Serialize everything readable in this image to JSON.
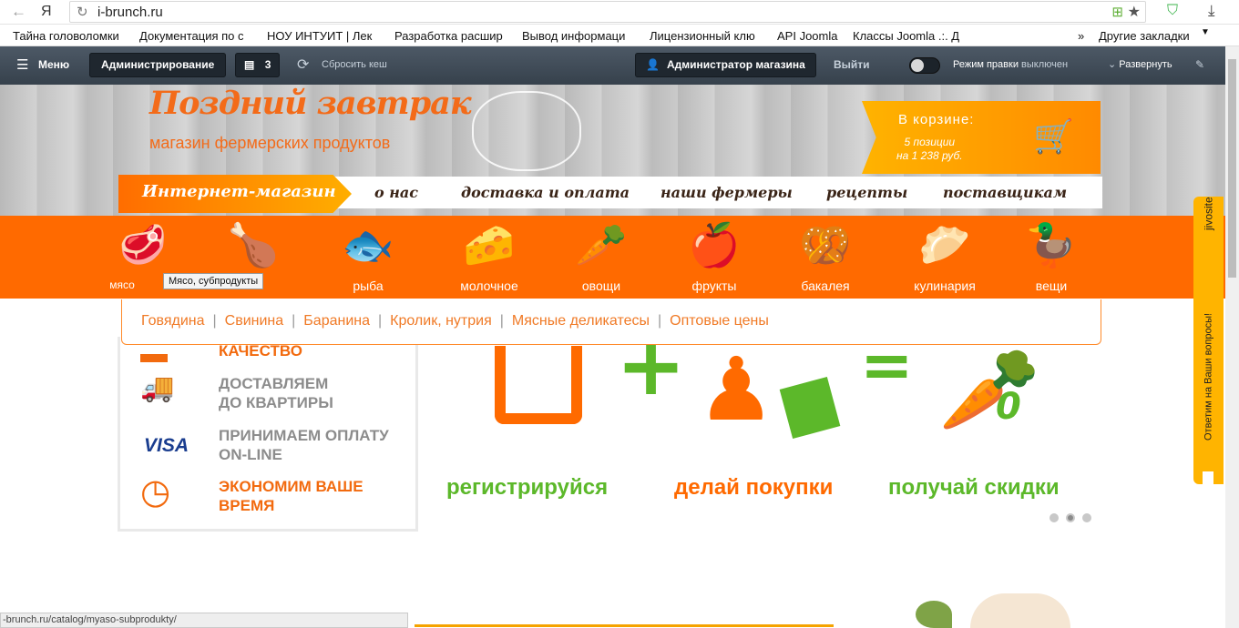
{
  "browser": {
    "yandex": "Я",
    "url": "i-brunch.ru",
    "bookmarks": [
      "Тайна головоломки",
      "Документация по с",
      "НОУ ИНТУИТ | Лек",
      "Разработка расшир",
      "Вывод информаци",
      "Лицензионный клю",
      "API Joomla",
      "Классы Joomla .:. Д"
    ],
    "other_bookmarks": "Другие закладки",
    "status_url": "-brunch.ru/catalog/myaso-subprodukty/"
  },
  "admin": {
    "menu": "Меню",
    "administration": "Администрирование",
    "count": "3",
    "clear_cache": "Сбросить кеш",
    "shop_admin": "Администратор магазина",
    "logout": "Выйти",
    "edit_mode": "Режим правки",
    "edit_state": "выключен",
    "expand": "Развернуть"
  },
  "header": {
    "logo_title": "Поздний завтрак",
    "logo_sub": "магазин фермерских продуктов",
    "cart_title": "В корзине:",
    "cart_line1": "5 позиции",
    "cart_line2": "на 1 238 руб.",
    "shop_tab": "Интернет-магазин",
    "menu": [
      "о нас",
      "доставка и оплата",
      "наши фермеры",
      "рецепты",
      "поставщикам"
    ]
  },
  "categories": [
    {
      "label": "мясо",
      "icon": "meat-icon"
    },
    {
      "label": "",
      "icon": "chicken-icon"
    },
    {
      "label": "рыба",
      "icon": "fish-icon"
    },
    {
      "label": "молочное",
      "icon": "dairy-icon"
    },
    {
      "label": "овощи",
      "icon": "vegetables-icon"
    },
    {
      "label": "фрукты",
      "icon": "fruits-icon"
    },
    {
      "label": "бакалея",
      "icon": "grocery-icon"
    },
    {
      "label": "кулинария",
      "icon": "cooking-icon"
    },
    {
      "label": "вещи",
      "icon": "things-icon"
    }
  ],
  "tooltip": "Мясо, субпродукты",
  "submenu": [
    "Говядина",
    "Свинина",
    "Баранина",
    "Кролик, нутрия",
    "Мясные деликатесы",
    "Оптовые цены"
  ],
  "features": [
    {
      "l1": "КАЧЕСТВО",
      "l2": "",
      "color": "#f26a0e"
    },
    {
      "l1": "ДОСТАВЛЯЕМ",
      "l2": "ДО КВАРТИРЫ",
      "color": "#8c8c8c"
    },
    {
      "l1": "ПРИНИМАЕМ ОПЛАТУ",
      "l2": "ON-LINE",
      "color": "#8c8c8c"
    },
    {
      "l1": "ЭКОНОМИМ ВАШЕ",
      "l2": "ВРЕМЯ",
      "color": "#f26a0e"
    }
  ],
  "visa": "VISA",
  "banner": {
    "cap1": "регистрируйся",
    "cap2": "делай покупки",
    "cap3": "получай скидки",
    "zero": "0"
  },
  "jivo": {
    "brand": "jivosite",
    "text": "Ответим на Ваши вопросы!"
  },
  "colors": {
    "orange": "#ff6a00",
    "green": "#5cb82a",
    "brown": "#3a2417"
  }
}
